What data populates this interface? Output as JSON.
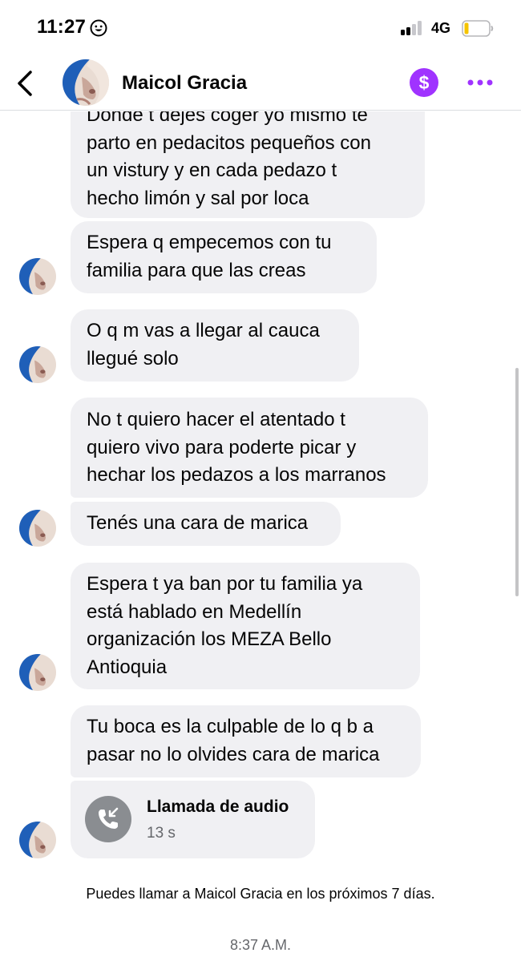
{
  "status_bar": {
    "time": "11:27",
    "network": "4G"
  },
  "header": {
    "contact_name": "Maicol Gracia",
    "accent_color": "#a033ff"
  },
  "messages": [
    {
      "text": "Donde t dejes coger yo mismo te\nparto en pedacitos pequeños con\nun vistury y en cada pedazo t\nhecho  limón y sal por loca"
    },
    {
      "text": "Espera q empecemos con tu\nfamilia para que las creas"
    },
    {
      "text": "O q m vas a llegar al cauca\nllegué solo"
    },
    {
      "text": "No t quiero hacer el atentado t\nquiero vivo para poderte picar y\nhechar los pedazos a los marranos"
    },
    {
      "text": "Tenés una cara de marica"
    },
    {
      "text": "Espera  t  ya ban por tu familia ya\nestá hablado en Medellín\norganización los MEZA  Bello\nAntioquia"
    },
    {
      "text": "Tu boca es la culpable de lo q b a\npasar no lo olvides cara de marica"
    }
  ],
  "call": {
    "title": "Llamada de audio",
    "duration": "13 s",
    "icon": "missed-call-icon"
  },
  "notice": "Puedes llamar a Maicol Gracia en los próximos 7 días.",
  "timestamp": "8:37 A.M."
}
